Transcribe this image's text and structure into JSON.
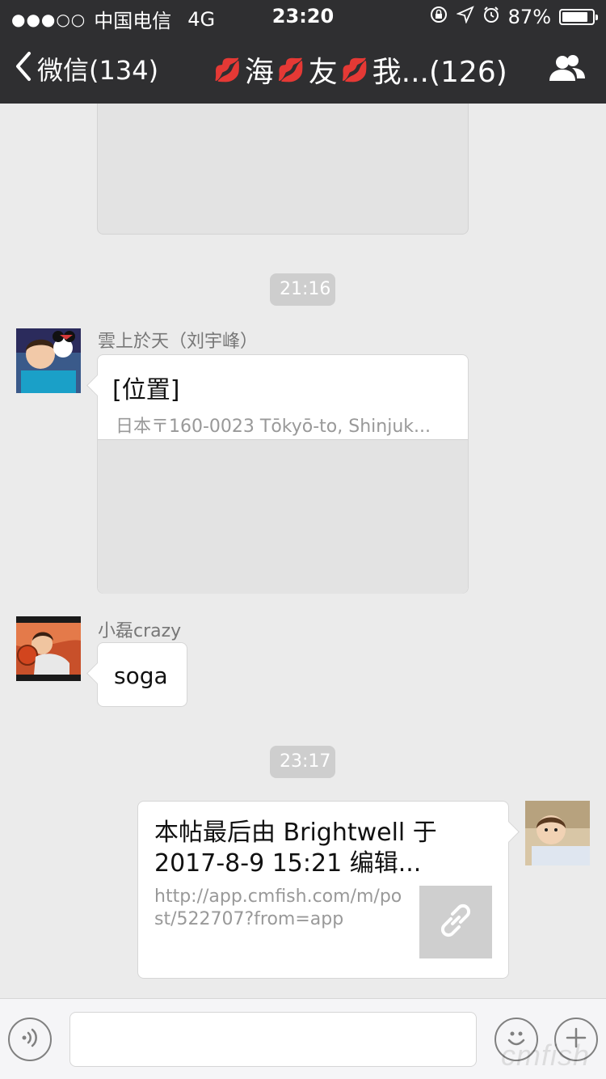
{
  "status_bar": {
    "signal": "●●●○○",
    "carrier": "中国电信",
    "network": "4G",
    "time": "23:20",
    "battery_percent": "87%",
    "battery_level": 0.87
  },
  "nav": {
    "back_label": "微信(134)",
    "title_parts": [
      "海",
      "友",
      "我...(126)"
    ],
    "emoji": "💋"
  },
  "chat": {
    "timestamps": [
      "21:16",
      "23:17"
    ],
    "messages": [
      {
        "sender": "雲上於天（刘宇峰）",
        "type": "location",
        "title": "[位置]",
        "address": "日本〒160-0023 Tōkyō-to, Shinjuk..."
      },
      {
        "sender": "小磊crazy",
        "type": "text",
        "text": "soga"
      },
      {
        "sender": "",
        "type": "link",
        "title": "本帖最后由 Brightwell 于 2017-8-9 15:21 编辑...",
        "url": "http://app.cmfish.com/m/post/522707?from=app"
      }
    ]
  },
  "input": {
    "placeholder": ""
  },
  "watermark": "cmfish"
}
